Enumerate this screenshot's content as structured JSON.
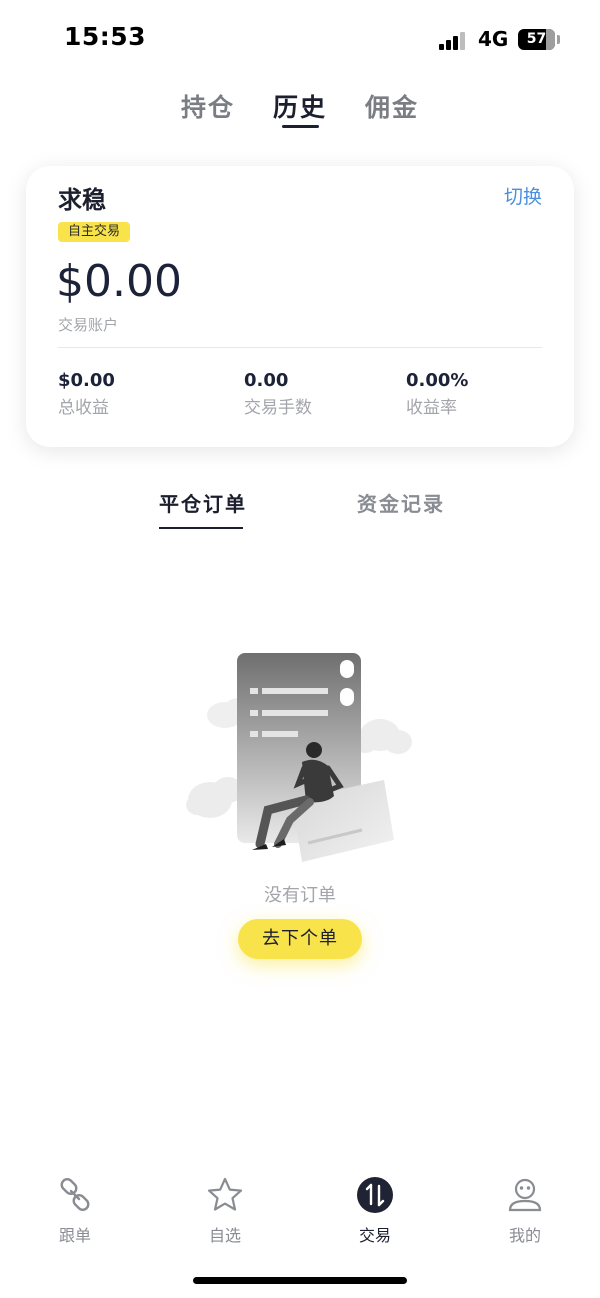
{
  "status_bar": {
    "time": "15:53",
    "network": "4G",
    "battery": "57"
  },
  "top_tabs": [
    {
      "label": "持仓"
    },
    {
      "label": "历史"
    },
    {
      "label": "佣金"
    }
  ],
  "account_card": {
    "name": "求稳",
    "switch_label": "切换",
    "badge": "自主交易",
    "balance": "$0.00",
    "balance_label": "交易账户",
    "stats": [
      {
        "value": "$0.00",
        "label": "总收益"
      },
      {
        "value": "0.00",
        "label": "交易手数"
      },
      {
        "value": "0.00%",
        "label": "收益率"
      }
    ]
  },
  "sub_tabs": [
    {
      "label": "平仓订单"
    },
    {
      "label": "资金记录"
    }
  ],
  "empty_state": {
    "message": "没有订单",
    "button_label": "去下个单"
  },
  "bottom_nav": [
    {
      "label": "跟单",
      "icon": "link-icon"
    },
    {
      "label": "自选",
      "icon": "star-icon"
    },
    {
      "label": "交易",
      "icon": "trade-icon"
    },
    {
      "label": "我的",
      "icon": "profile-icon"
    }
  ],
  "colors": {
    "accent_yellow": "#f8e34a",
    "link_blue": "#4a8fe0",
    "text_dark": "#1c1f2e",
    "text_muted": "#a3a5ab"
  }
}
